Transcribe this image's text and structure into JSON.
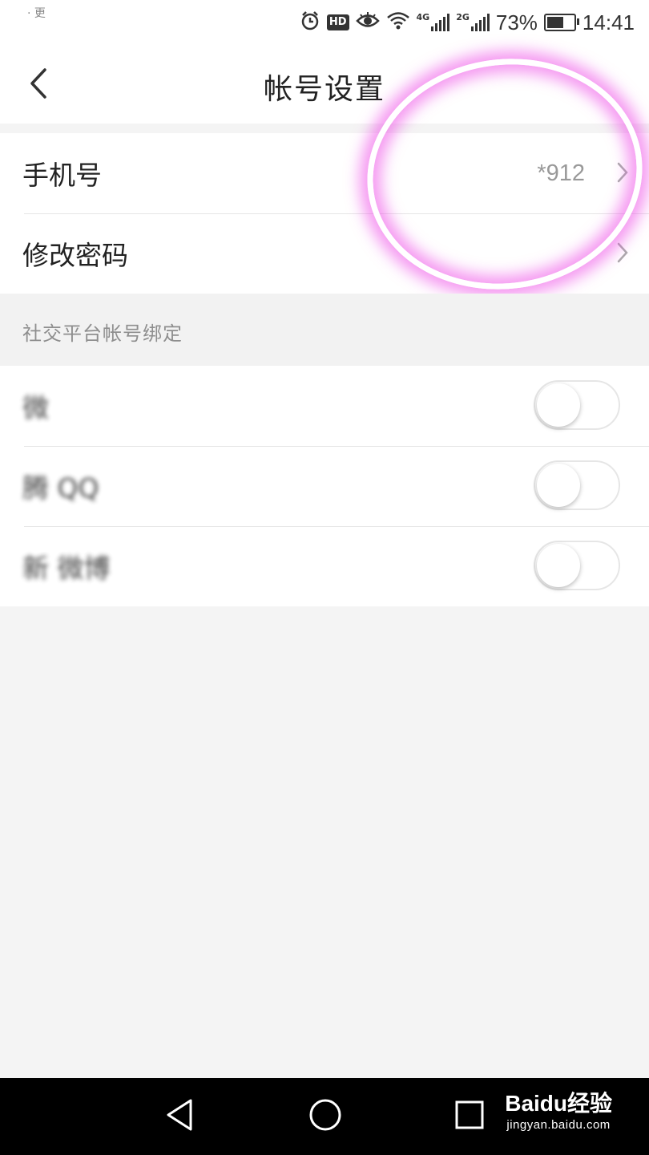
{
  "status_bar": {
    "left_text": "· 更",
    "network_4g": "4G",
    "network_2g": "2G",
    "battery_percent": "73%",
    "time": "14:41",
    "battery_level": 0.73,
    "icons": [
      "alarm-icon",
      "hd-icon",
      "eye-icon",
      "wifi-icon",
      "signal-icon",
      "battery-icon"
    ]
  },
  "header": {
    "title": "帐号设置",
    "back_icon": "back-chevron-icon"
  },
  "account": {
    "phone": {
      "label": "手机号",
      "value": "*912"
    },
    "password": {
      "label": "修改密码"
    }
  },
  "social": {
    "section_title": "社交平台帐号绑定",
    "items": [
      {
        "label": "微",
        "enabled": false
      },
      {
        "label": "腾 QQ",
        "enabled": false
      },
      {
        "label": "新 微博",
        "enabled": false
      }
    ]
  },
  "system_nav": {
    "icons": [
      "back-triangle-icon",
      "home-circle-icon",
      "recent-square-icon"
    ]
  },
  "watermark": {
    "main": "Baidu经验",
    "sub": "jingyan.baidu.com"
  },
  "colors": {
    "annotation": "#ec46e6",
    "background": "#f4f4f4",
    "divider": "#e6e6e6"
  }
}
